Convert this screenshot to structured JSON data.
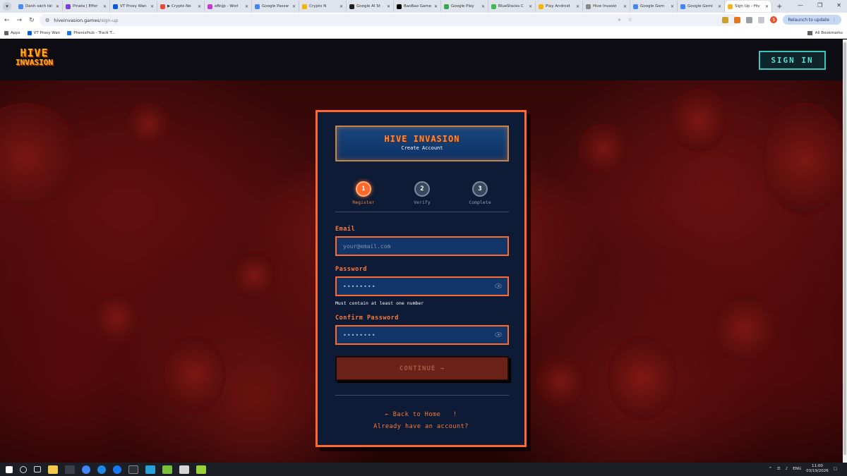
{
  "browser": {
    "tabs": [
      {
        "title": "Danh sách tài",
        "color": "#4a8af4"
      },
      {
        "title": "Pinata | Effor",
        "color": "#7b3fe4"
      },
      {
        "title": "VT Proxy Wan",
        "color": "#0b5cd5"
      },
      {
        "title": "▶ Crypto Ne",
        "color": "#e94b3c"
      },
      {
        "title": "eBnJp - Worl",
        "color": "#c53bd1"
      },
      {
        "title": "Google Passw",
        "color": "#4285f4"
      },
      {
        "title": "Crypto N",
        "color": "#f4b400"
      },
      {
        "title": "Google AI St",
        "color": "#222222"
      },
      {
        "title": "BaoBao Game",
        "color": "#000000"
      },
      {
        "title": "Google Play",
        "color": "#34a853"
      },
      {
        "title": "BlueStacks C",
        "color": "#3dba4e"
      },
      {
        "title": "Play Android",
        "color": "#f4b400"
      },
      {
        "title": "Hive Invasio",
        "color": "#888888"
      },
      {
        "title": "Google Gem",
        "color": "#4285f4"
      },
      {
        "title": "Google Gemi",
        "color": "#4285f4"
      },
      {
        "title": "Sign Up - Hiv",
        "color": "#f6b21a",
        "active": true
      }
    ],
    "url_host": "hiveinvasion.games",
    "url_path": "/sign-up",
    "relaunch_label": "Relaunch to update",
    "avatar_letter": "S",
    "bookmarks": [
      "Apps",
      "VT Proxy Wan",
      "PhenixHub - Track T..."
    ],
    "all_bookmarks_label": "All Bookmarks"
  },
  "site": {
    "logo_line1": "HIVE",
    "logo_line2": "INVASION",
    "signin_label": "SIGN IN"
  },
  "card": {
    "title": "HIVE INVASION",
    "subtitle": "Create Account",
    "steps": [
      {
        "number": "1",
        "label": "Register",
        "active": true
      },
      {
        "number": "2",
        "label": "Verify",
        "active": false
      },
      {
        "number": "3",
        "label": "Complete",
        "active": false
      }
    ],
    "email_label": "Email",
    "email_placeholder": "your@email.com",
    "password_label": "Password",
    "password_value": "••••••••",
    "password_hint": "Must contain at least one number",
    "confirm_label": "Confirm Password",
    "confirm_value": "••••••••",
    "continue_label": "CONTINUE →",
    "back_home_label": "← Back to Home",
    "back_home_suffix": "!",
    "have_account_label": "Already have an account?"
  },
  "taskbar": {
    "lang": "ENG",
    "time": "11:00",
    "date": "03/19/2026"
  }
}
